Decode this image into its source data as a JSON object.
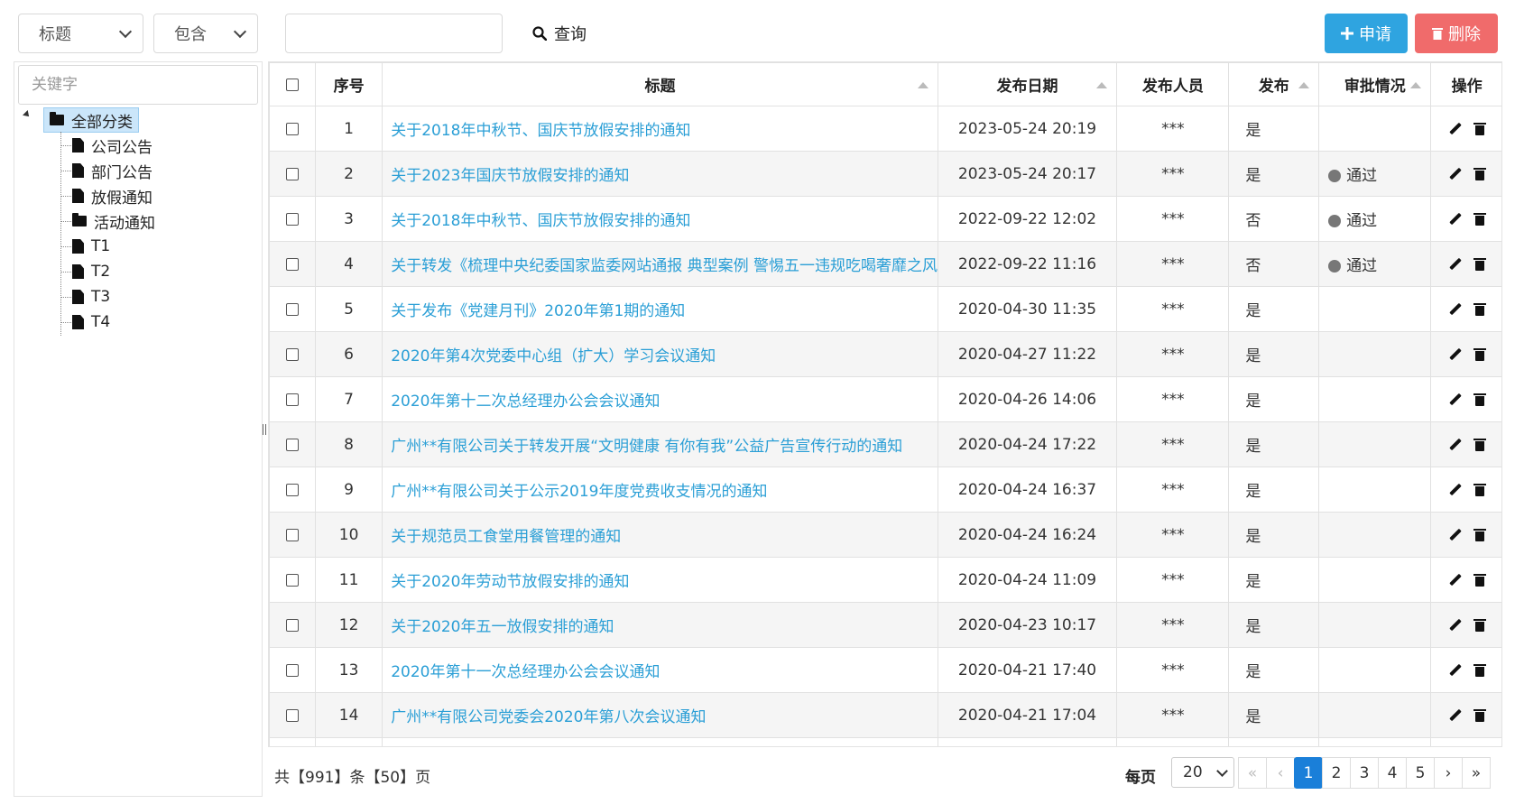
{
  "toolbar": {
    "field_select": "标题",
    "operator_select": "包含",
    "search_value": "",
    "query_label": "查询",
    "apply_label": "申请",
    "delete_label": "删除"
  },
  "sidebar": {
    "keyword_placeholder": "关键字",
    "root_label": "全部分类",
    "items": [
      {
        "label": "公司公告",
        "type": "file"
      },
      {
        "label": "部门公告",
        "type": "file"
      },
      {
        "label": "放假通知",
        "type": "file"
      },
      {
        "label": "活动通知",
        "type": "folder"
      },
      {
        "label": "T1",
        "type": "file"
      },
      {
        "label": "T2",
        "type": "file"
      },
      {
        "label": "T3",
        "type": "file"
      },
      {
        "label": "T4",
        "type": "file"
      }
    ]
  },
  "table": {
    "headers": {
      "seq": "序号",
      "title": "标题",
      "date": "发布日期",
      "publisher": "发布人员",
      "published": "发布",
      "approval": "审批情况",
      "ops": "操作"
    },
    "rows": [
      {
        "seq": "1",
        "title": "关于2018年中秋节、国庆节放假安排的通知",
        "date": "2023-05-24 20:19",
        "publisher": "***",
        "published": "是",
        "approval": ""
      },
      {
        "seq": "2",
        "title": "关于2023年国庆节放假安排的通知",
        "date": "2023-05-24 20:17",
        "publisher": "***",
        "published": "是",
        "approval": "通过"
      },
      {
        "seq": "3",
        "title": "关于2018年中秋节、国庆节放假安排的通知",
        "date": "2022-09-22 12:02",
        "publisher": "***",
        "published": "否",
        "approval": "通过"
      },
      {
        "seq": "4",
        "title": "关于转发《梳理中央纪委国家监委网站通报 典型案例 警惕五一违规吃喝奢靡之风",
        "date": "2022-09-22 11:16",
        "publisher": "***",
        "published": "否",
        "approval": "通过"
      },
      {
        "seq": "5",
        "title": "关于发布《党建月刊》2020年第1期的通知",
        "date": "2020-04-30 11:35",
        "publisher": "***",
        "published": "是",
        "approval": ""
      },
      {
        "seq": "6",
        "title": "2020年第4次党委中心组（扩大）学习会议通知",
        "date": "2020-04-27 11:22",
        "publisher": "***",
        "published": "是",
        "approval": ""
      },
      {
        "seq": "7",
        "title": "2020年第十二次总经理办公会会议通知",
        "date": "2020-04-26 14:06",
        "publisher": "***",
        "published": "是",
        "approval": ""
      },
      {
        "seq": "8",
        "title": "广州**有限公司关于转发开展“文明健康 有你有我”公益广告宣传行动的通知",
        "date": "2020-04-24 17:22",
        "publisher": "***",
        "published": "是",
        "approval": ""
      },
      {
        "seq": "9",
        "title": "广州**有限公司关于公示2019年度党费收支情况的通知",
        "date": "2020-04-24 16:37",
        "publisher": "***",
        "published": "是",
        "approval": ""
      },
      {
        "seq": "10",
        "title": "关于规范员工食堂用餐管理的通知",
        "date": "2020-04-24 16:24",
        "publisher": "***",
        "published": "是",
        "approval": ""
      },
      {
        "seq": "11",
        "title": "关于2020年劳动节放假安排的通知",
        "date": "2020-04-24 11:09",
        "publisher": "***",
        "published": "是",
        "approval": ""
      },
      {
        "seq": "12",
        "title": "关于2020年五一放假安排的通知",
        "date": "2020-04-23 10:17",
        "publisher": "***",
        "published": "是",
        "approval": ""
      },
      {
        "seq": "13",
        "title": "2020年第十一次总经理办公会会议通知",
        "date": "2020-04-21 17:40",
        "publisher": "***",
        "published": "是",
        "approval": ""
      },
      {
        "seq": "14",
        "title": "广州**有限公司党委会2020年第八次会议通知",
        "date": "2020-04-21 17:04",
        "publisher": "***",
        "published": "是",
        "approval": ""
      }
    ]
  },
  "footer": {
    "total_text": "共【991】条【50】页",
    "per_page_label": "每页",
    "per_page_value": "20",
    "pages": [
      "1",
      "2",
      "3",
      "4",
      "5"
    ],
    "current_page": "1",
    "first_glyph": "«",
    "prev_glyph": "‹",
    "next_glyph": "›",
    "last_glyph": "»"
  },
  "colors": {
    "apply_button": "#2fa4e0",
    "delete_button": "#f06b6b",
    "link": "#2b9fd6",
    "active_page": "#1a7fd9",
    "tree_selected": "#cbe6fa"
  },
  "icons": {
    "query": "search-icon",
    "apply": "plus-icon",
    "delete": "trash-icon",
    "edit": "pencil-icon",
    "row_delete": "trash-icon",
    "tree_folder": "folder-icon",
    "tree_file": "file-icon"
  }
}
